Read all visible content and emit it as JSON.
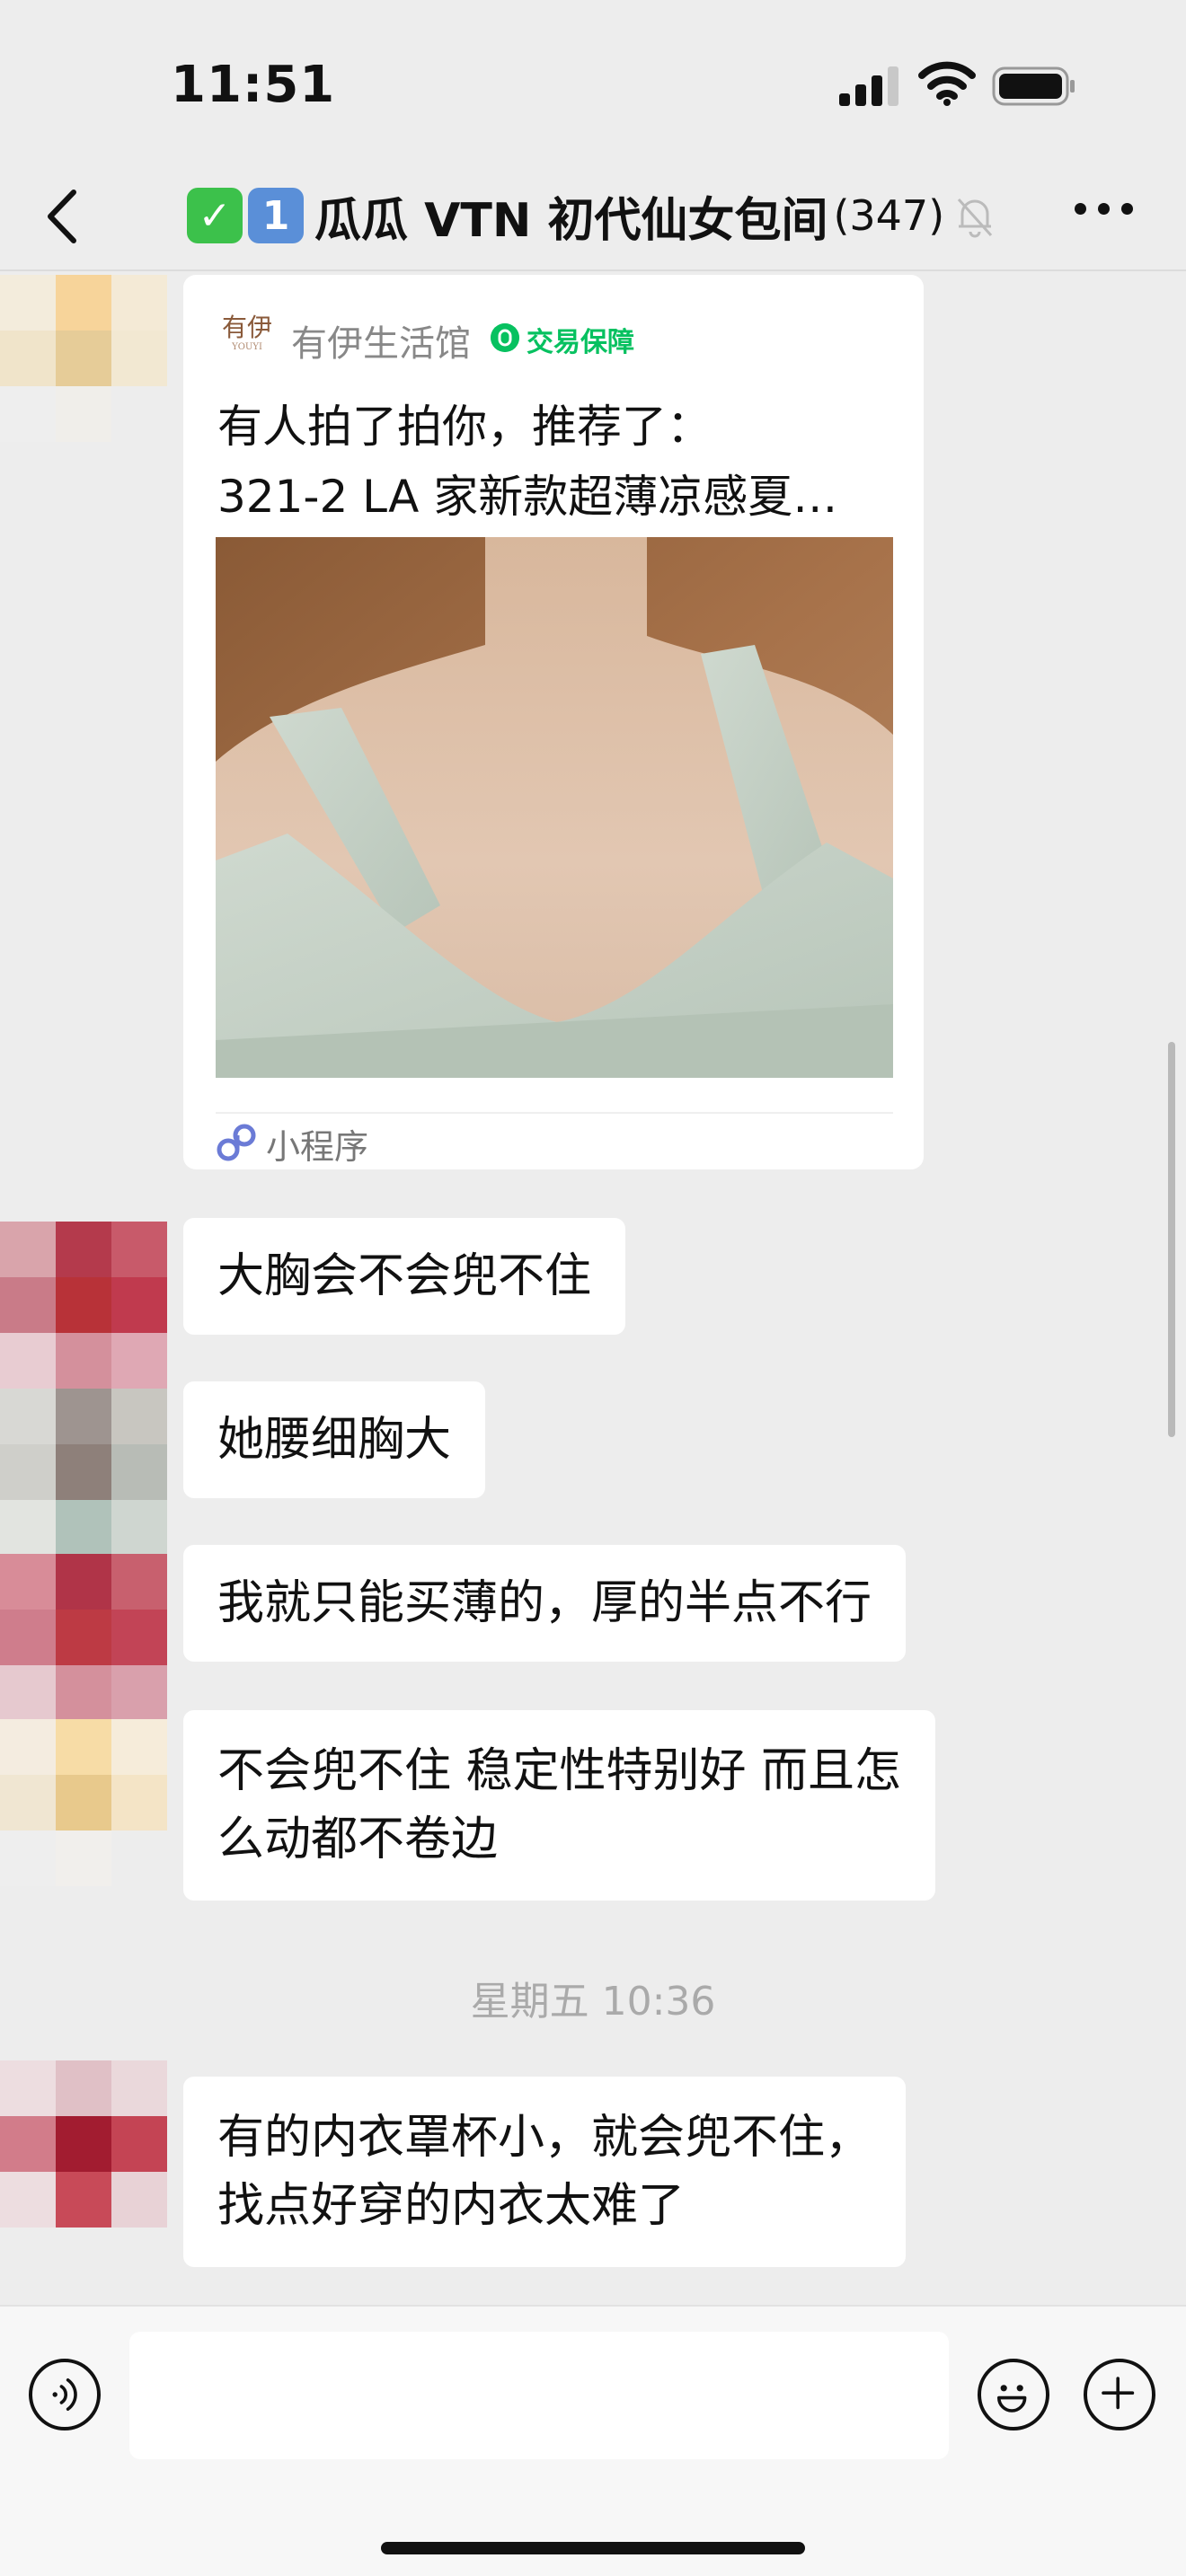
{
  "status_bar": {
    "time": "11:51",
    "icons": [
      "cellular-signal-icon",
      "wifi-icon",
      "battery-icon"
    ]
  },
  "nav": {
    "back_icon": "chevron-left-icon",
    "title_badges": [
      "✅",
      "1"
    ],
    "title": "瓜瓜 VTN 初代仙女包间",
    "member_count": "(347)",
    "muted_icon": "bell-off-icon",
    "more_icon": "ellipsis-icon"
  },
  "card": {
    "shop_logo_text": "有伊",
    "shop_name": "有伊生活馆",
    "guarantee_label": "交易保障",
    "title_line1": "有人拍了拍你，推荐了：",
    "title_line2": "321-2 LA 家新款超薄凉感夏…",
    "footer_label": "小程序",
    "footer_icon": "mini-program-icon",
    "image_description": "product-photo"
  },
  "messages": [
    {
      "text": "大胸会不会兜不住"
    },
    {
      "text": "她腰细胸大"
    },
    {
      "text": "我就只能买薄的，厚的半点不行"
    },
    {
      "line1": "不会兜不住 稳定性特别好 而且怎",
      "line2": "么动都不卷边"
    },
    {
      "line1": "有的内衣罩杯小，就会兜不住，",
      "line2": "找点好穿的内衣太难了"
    }
  ],
  "time_divider": "星期五 10:36",
  "input_bar": {
    "voice_icon": "voice-icon",
    "emoji_icon": "emoji-icon",
    "plus_icon": "plus-icon",
    "input_value": ""
  },
  "colors": {
    "background": "#ededed",
    "bubble": "#ffffff",
    "guarantee_green": "#07c160",
    "timestamp_gray": "#aaaaaa"
  }
}
